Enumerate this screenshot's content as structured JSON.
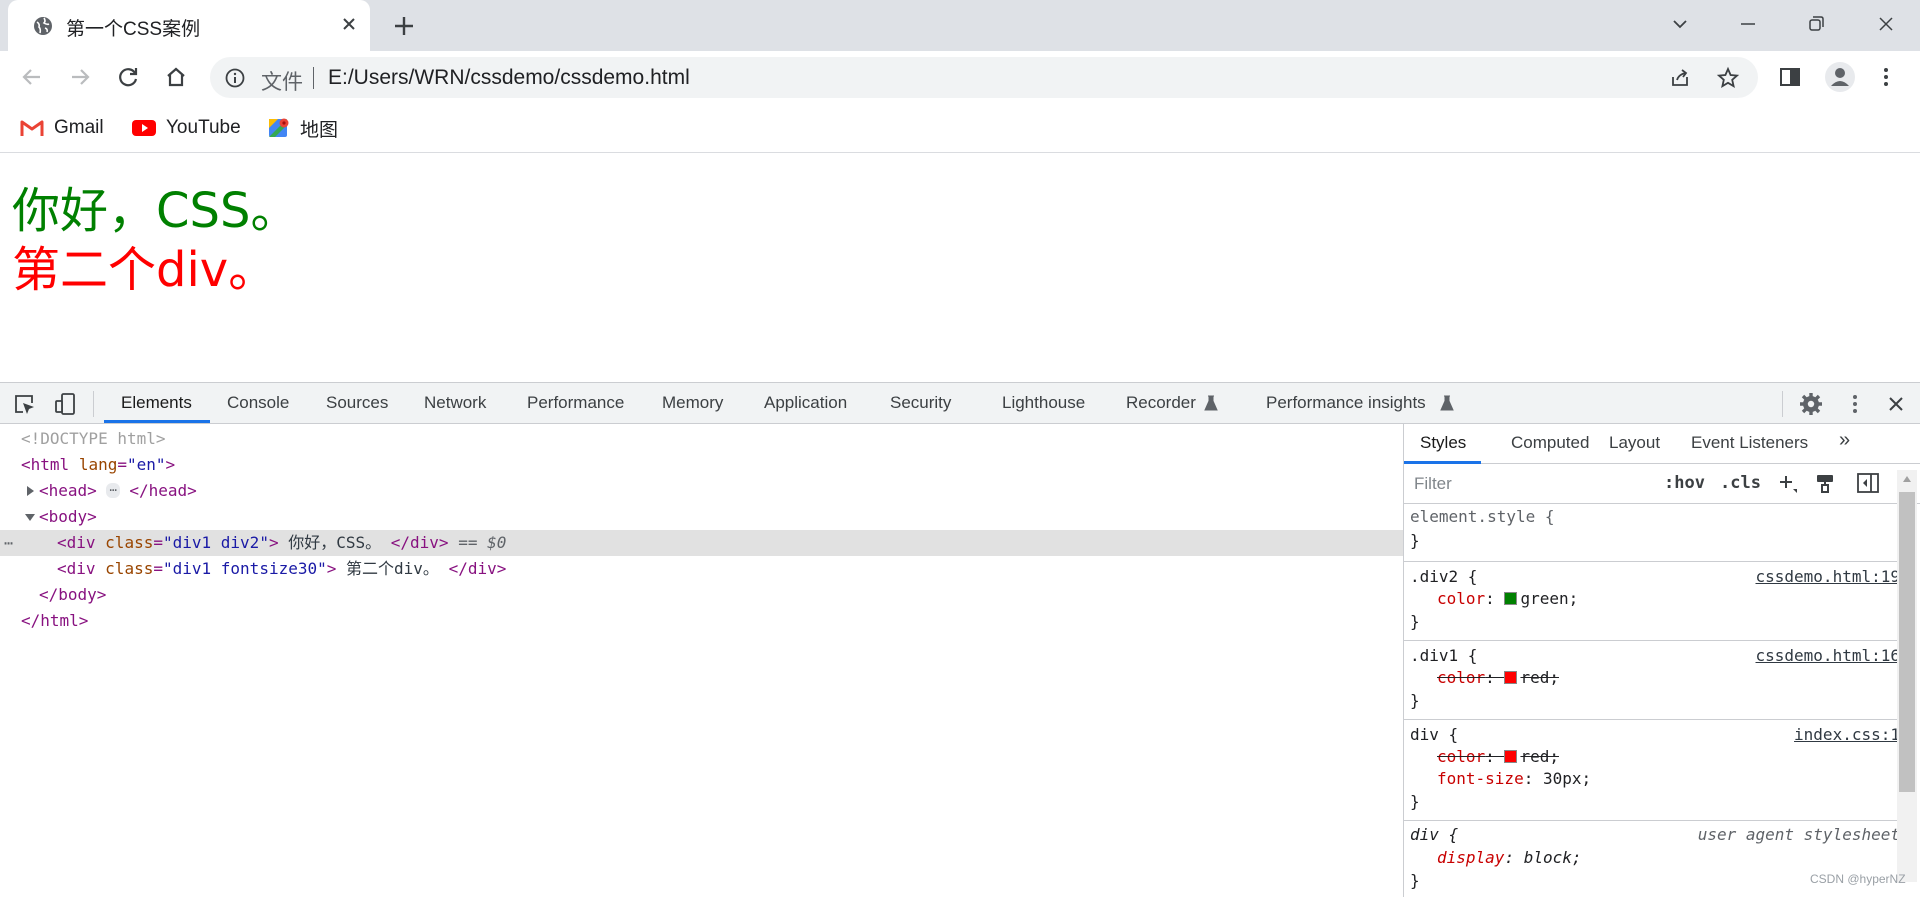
{
  "browser": {
    "tab_title": "第一个CSS案例",
    "omnibox": {
      "scheme_label": "文件",
      "url": "E:/Users/WRN/cssdemo/cssdemo.html"
    },
    "bookmarks": [
      {
        "label": "Gmail",
        "icon": "gmail-icon"
      },
      {
        "label": "YouTube",
        "icon": "youtube-icon"
      },
      {
        "label": "地图",
        "icon": "maps-icon"
      }
    ]
  },
  "page": {
    "line1": "你好，CSS。",
    "line2": "第二个div。"
  },
  "devtools": {
    "tabs": [
      "Elements",
      "Console",
      "Sources",
      "Network",
      "Performance",
      "Memory",
      "Application",
      "Security",
      "Lighthouse",
      "Recorder",
      "Performance insights"
    ],
    "active_tab": "Elements",
    "dom": {
      "doctype": "<!DOCTYPE html>",
      "html_open_tag": "<html",
      "html_attr": "lang",
      "html_attr_val": "\"en\"",
      "gt": ">",
      "head_open": "<head>",
      "head_close": "</head>",
      "ellipsis": "⋯",
      "body_open": "<body>",
      "div_open": "<div",
      "class_attr": "class",
      "div1_class": "\"div1 div2\"",
      "div1_text": " 你好，CSS。 ",
      "div2_class": "\"div1 fontsize30\"",
      "div2_text": " 第二个div。 ",
      "div_close": "</div>",
      "selected_marker": "== $0",
      "body_close": "</body>",
      "html_close": "</html>",
      "row_dots": "⋯",
      "equals": "="
    },
    "styles_tabs": [
      "Styles",
      "Computed",
      "Layout",
      "Event Listeners"
    ],
    "more_tabs": "»",
    "filter_placeholder": "Filter",
    "hov": ":hov",
    "cls": ".cls",
    "rules": [
      {
        "selector": "element.style {",
        "source": "",
        "decls": []
      },
      {
        "selector": ".div2 {",
        "source": "cssdemo.html:19",
        "decls": [
          {
            "prop": "color",
            "value": "green;",
            "swatch": "#008000",
            "struck": false
          }
        ]
      },
      {
        "selector": ".div1 {",
        "source": "cssdemo.html:16",
        "decls": [
          {
            "prop": "color",
            "value": "red;",
            "swatch": "#ff0000",
            "struck": true
          }
        ]
      },
      {
        "selector": "div {",
        "source": "index.css:1",
        "decls": [
          {
            "prop": "color",
            "value": "red;",
            "swatch": "#ff0000",
            "struck": true
          },
          {
            "prop": "font-size",
            "value": "30px;",
            "swatch": "",
            "struck": false
          }
        ]
      },
      {
        "selector": "div {",
        "source": "user agent stylesheet",
        "decls": [
          {
            "prop": "display",
            "value": "block;",
            "swatch": "",
            "struck": false
          }
        ]
      }
    ],
    "close_brace": "}",
    "colon": ": "
  },
  "watermark": "CSDN @hyperNZ",
  "colors": {
    "accent": "#1a73e8",
    "tag": "#881280",
    "attr_name": "#994500",
    "attr_value": "#1a1aa6",
    "prop": "#c80000"
  }
}
